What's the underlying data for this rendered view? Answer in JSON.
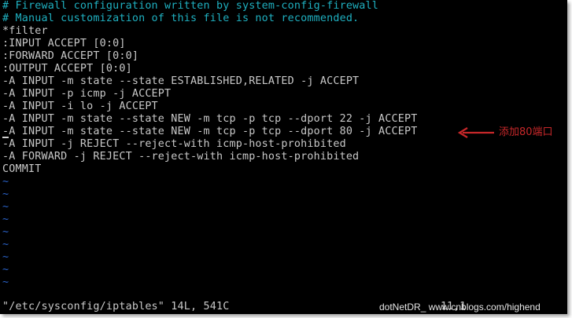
{
  "editor": {
    "lines": [
      {
        "text": "# Firewall configuration written by system-config-firewall",
        "kind": "comment"
      },
      {
        "text": "# Manual customization of this file is not recommended.",
        "kind": "comment"
      },
      {
        "text": "*filter",
        "kind": "normal"
      },
      {
        "text": ":INPUT ACCEPT [0:0]",
        "kind": "normal"
      },
      {
        "text": ":FORWARD ACCEPT [0:0]",
        "kind": "normal"
      },
      {
        "text": ":OUTPUT ACCEPT [0:0]",
        "kind": "normal"
      },
      {
        "text": "-A INPUT -m state --state ESTABLISHED,RELATED -j ACCEPT",
        "kind": "normal"
      },
      {
        "text": "-A INPUT -p icmp -j ACCEPT",
        "kind": "normal"
      },
      {
        "text": "-A INPUT -i lo -j ACCEPT",
        "kind": "normal"
      },
      {
        "text": "-A INPUT -m state --state NEW -m tcp -p tcp --dport 22 -j ACCEPT",
        "kind": "normal"
      },
      {
        "text": "-A INPUT -m state --state NEW -m tcp -p tcp --dport 80 -j ACCEPT",
        "kind": "normal"
      },
      {
        "text": "-A INPUT -j REJECT --reject-with icmp-host-prohibited",
        "kind": "normal"
      },
      {
        "text": "-A FORWARD -j REJECT --reject-with icmp-host-prohibited",
        "kind": "normal"
      },
      {
        "text": "COMMIT",
        "kind": "normal"
      },
      {
        "text": "~",
        "kind": "tilde"
      },
      {
        "text": "~",
        "kind": "tilde"
      },
      {
        "text": "~",
        "kind": "tilde"
      },
      {
        "text": "~",
        "kind": "tilde"
      },
      {
        "text": "~",
        "kind": "tilde"
      },
      {
        "text": "~",
        "kind": "tilde"
      },
      {
        "text": "~",
        "kind": "tilde"
      },
      {
        "text": "~",
        "kind": "tilde"
      },
      {
        "text": "~",
        "kind": "tilde"
      }
    ],
    "status_line": "\"/etc/sysconfig/iptables\" 14L, 541C",
    "cursor_position": "11,1"
  },
  "annotation": {
    "text": "添加80端口",
    "color": "#c8282a"
  },
  "watermark": {
    "text": "dotNetDR_ www.cnblogs.com/highend"
  },
  "colors": {
    "background": "#000000",
    "text": "#c8c8c8",
    "comment": "#1fb0c0",
    "tilde": "#2a62c8"
  }
}
